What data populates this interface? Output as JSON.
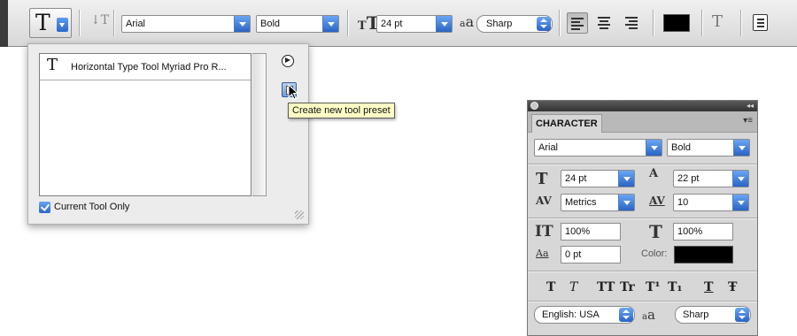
{
  "options_bar": {
    "tool_icon": "T",
    "orientation_icon": "↓T",
    "font_family": "Arial",
    "font_style": "Bold",
    "size_icon": "T",
    "font_size": "24 pt",
    "aa_icon": "a",
    "antialias_icon_small": "a",
    "antialias": "Sharp",
    "warp_icon": "T",
    "align_selected": "left",
    "text_color": "#000000"
  },
  "preset_popup": {
    "item_icon": "T",
    "preset_item": "Horizontal Type Tool Myriad Pro R...",
    "tooltip": "Create new tool preset",
    "current_tool_only_label": "Current Tool Only",
    "current_tool_only_checked": true
  },
  "character_panel": {
    "tab_title": "CHARACTER",
    "menu_icon": "▾≡",
    "font_family": "Arial",
    "font_style": "Bold",
    "size_icon": "T",
    "font_size": "24 pt",
    "leading_icon": "A",
    "leading": "22 pt",
    "kerning_icon": "AV",
    "kerning": "Metrics",
    "tracking_icon": "AV",
    "tracking": "10",
    "vscale_icon": "IT",
    "vertical_scale": "100%",
    "hscale_icon": "T",
    "horizontal_scale": "100%",
    "baseline_icon": "Aa",
    "baseline_shift": "0 pt",
    "color_label": "Color:",
    "color": "#000000",
    "styles": [
      "T",
      "T",
      "TT",
      "Tr",
      "T¹",
      "T₁",
      "T",
      "Ŧ"
    ],
    "language": "English: USA",
    "aa_icon": "a",
    "aa_icon_small": "a",
    "antialias": "Sharp"
  }
}
